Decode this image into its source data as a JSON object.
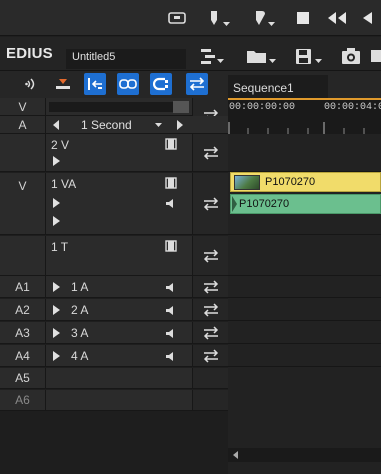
{
  "app": {
    "brand": "EDIUS",
    "project_name": "Untitled5"
  },
  "sequence": {
    "tab_label": "Sequence1",
    "timecodes": [
      "00:00:00:00",
      "00:00:04:0"
    ]
  },
  "header_controls": {
    "v_label": "V",
    "a_label": "A",
    "zoom_value": "1 Second"
  },
  "tracks": [
    {
      "patch": "",
      "name": "2 V",
      "type": "video"
    },
    {
      "patch": "V",
      "name": "1 VA",
      "type": "videoaudio"
    },
    {
      "patch": "",
      "name": "1 T",
      "type": "title"
    },
    {
      "patch": "A1",
      "name": "1 A",
      "type": "audio"
    },
    {
      "patch": "A2",
      "name": "2 A",
      "type": "audio"
    },
    {
      "patch": "A3",
      "name": "3 A",
      "type": "audio"
    },
    {
      "patch": "A4",
      "name": "4 A",
      "type": "audio"
    },
    {
      "patch": "A5",
      "name": "",
      "type": "empty"
    },
    {
      "patch": "A6",
      "name": "",
      "type": "empty"
    }
  ],
  "clips": {
    "video_clip_name": "P1070270",
    "audio_clip_name": "P1070270",
    "video_color": "#f1dc6a",
    "audio_color": "#6bbf8e"
  },
  "colors": {
    "accent_blue": "#1e6fd2",
    "playhead_orange": "#e09a2c"
  }
}
